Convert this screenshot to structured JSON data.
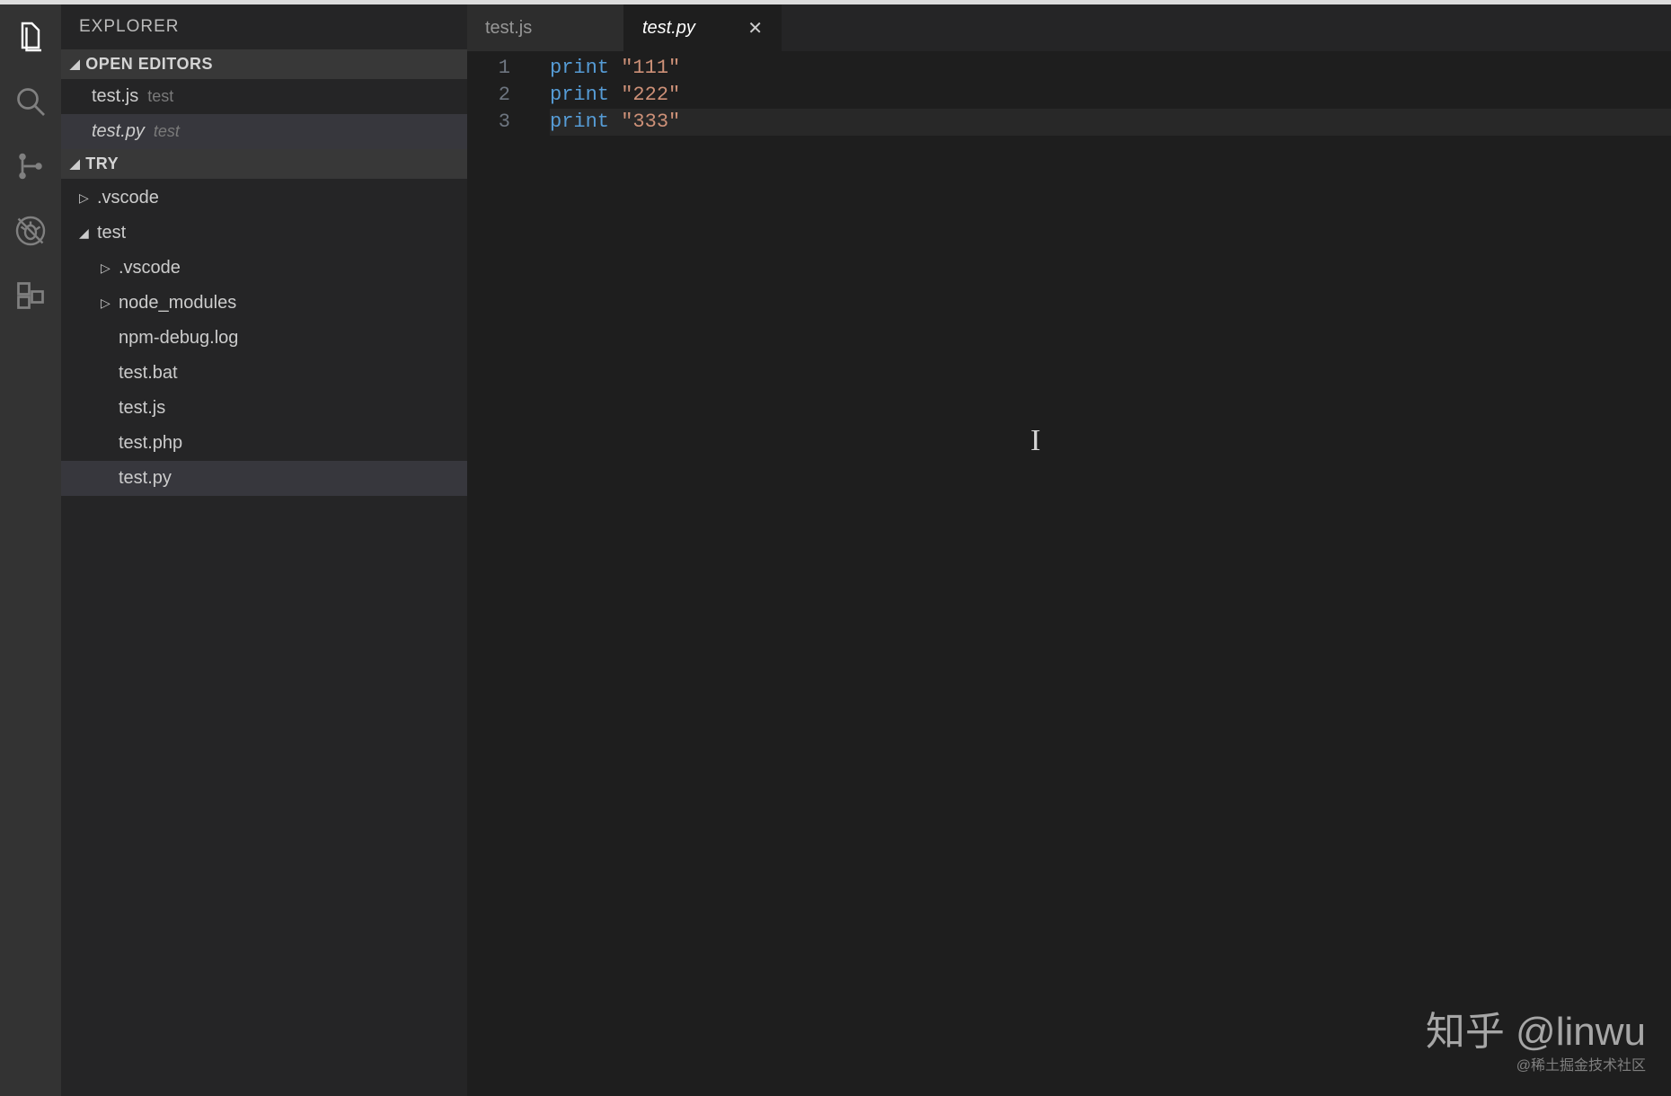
{
  "sidebar": {
    "title": "EXPLORER",
    "sections": {
      "openEditors": {
        "label": "OPEN EDITORS",
        "items": [
          {
            "name": "test.js",
            "dir": "test"
          },
          {
            "name": "test.py",
            "dir": "test"
          }
        ]
      },
      "workspace": {
        "label": "TRY",
        "tree": [
          {
            "name": ".vscode",
            "type": "folder",
            "expanded": false,
            "level": 1
          },
          {
            "name": "test",
            "type": "folder",
            "expanded": true,
            "level": 1
          },
          {
            "name": ".vscode",
            "type": "folder",
            "expanded": false,
            "level": 2
          },
          {
            "name": "node_modules",
            "type": "folder",
            "expanded": false,
            "level": 2
          },
          {
            "name": "npm-debug.log",
            "type": "file",
            "level": 2
          },
          {
            "name": "test.bat",
            "type": "file",
            "level": 2
          },
          {
            "name": "test.js",
            "type": "file",
            "level": 2
          },
          {
            "name": "test.php",
            "type": "file",
            "level": 2
          },
          {
            "name": "test.py",
            "type": "file",
            "level": 2,
            "selected": true
          }
        ]
      }
    }
  },
  "tabs": [
    {
      "label": "test.js",
      "active": false
    },
    {
      "label": "test.py",
      "active": true
    }
  ],
  "code": {
    "lines": [
      {
        "num": "1",
        "keyword": "print",
        "string": "\"111\""
      },
      {
        "num": "2",
        "keyword": "print",
        "string": "\"222\""
      },
      {
        "num": "3",
        "keyword": "print",
        "string": "\"333\""
      }
    ]
  },
  "watermark": {
    "main": "知乎 @linwu",
    "sub": "@稀土掘金技术社区"
  }
}
